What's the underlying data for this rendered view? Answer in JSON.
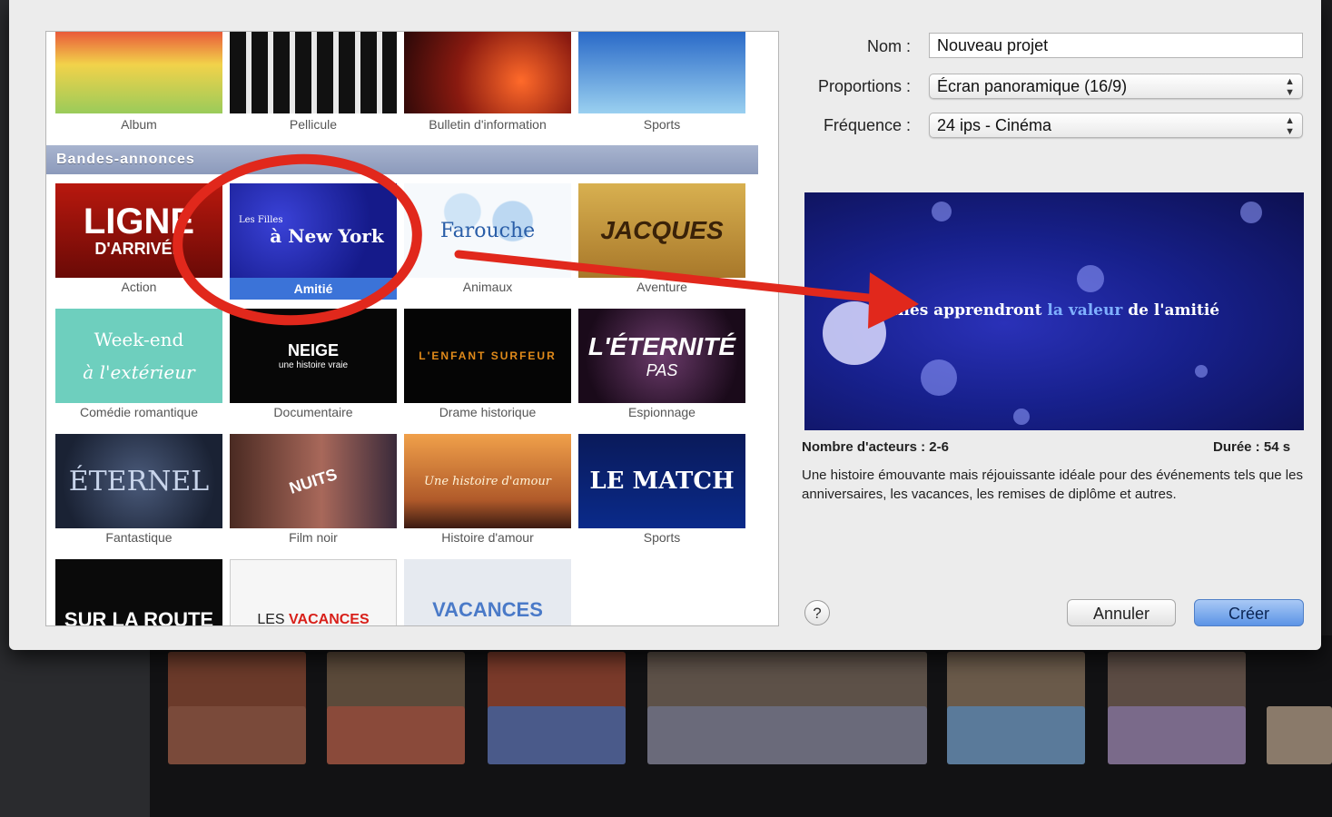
{
  "form": {
    "name_label": "Nom :",
    "name_value": "Nouveau projet",
    "proportions_label": "Proportions :",
    "proportions_value": "Écran panoramique (16/9)",
    "frequency_label": "Fréquence :",
    "frequency_value": "24 ips - Cinéma"
  },
  "themes_top_row": [
    {
      "label": "Album"
    },
    {
      "label": "Pellicule"
    },
    {
      "label": "Bulletin d'information"
    },
    {
      "label": "Sports"
    }
  ],
  "trailers": {
    "header": "Bandes-annonces",
    "items": [
      {
        "label": "Action",
        "thumb_text": "LIGNE",
        "thumb_sub": "D'ARRIVÉE"
      },
      {
        "label": "Amitié",
        "thumb_text": "à New York",
        "thumb_sub": "Les Filles",
        "selected": true
      },
      {
        "label": "Animaux",
        "thumb_text": "Farouche"
      },
      {
        "label": "Aventure",
        "thumb_text": "JACQUES"
      },
      {
        "label": "Comédie romantique",
        "thumb_text": "Week-end",
        "thumb_sub": "à l'extérieur"
      },
      {
        "label": "Documentaire",
        "thumb_text": "NEIGE",
        "thumb_sub": "une histoire vraie"
      },
      {
        "label": "Drame historique",
        "thumb_text": "L'ENFANT SURFEUR"
      },
      {
        "label": "Espionnage",
        "thumb_text": "L'ÉTERNITÉ",
        "thumb_sub": "PAS"
      },
      {
        "label": "Fantastique",
        "thumb_text": "ÉTERNEL"
      },
      {
        "label": "Film noir",
        "thumb_text": "NUITS"
      },
      {
        "label": "Histoire d'amour",
        "thumb_text": "Une histoire d'amour"
      },
      {
        "label": "Sports",
        "thumb_text": "LE MATCH"
      },
      {
        "thumb_text": "SUR LA ROUTE"
      },
      {
        "thumb_text": "VACANCES",
        "thumb_sub": "LES"
      },
      {
        "thumb_text": "VACANCES"
      }
    ]
  },
  "preview": {
    "text_start": "Elles apprendront",
    "text_highlight": "la valeur",
    "text_end": "de l'amitié"
  },
  "details": {
    "actors": "Nombre d'acteurs : 2-6",
    "duration": "Durée : 54 s",
    "description": "Une histoire émouvante mais réjouissante idéale pour des événements tels que les anniversaires, les vacances, les remises de diplôme et autres."
  },
  "buttons": {
    "help": "?",
    "cancel": "Annuler",
    "create": "Créer"
  },
  "colors": {
    "annotation": "#e1281c",
    "selection": "#3b73d8",
    "create_button": "#5c94e6"
  }
}
